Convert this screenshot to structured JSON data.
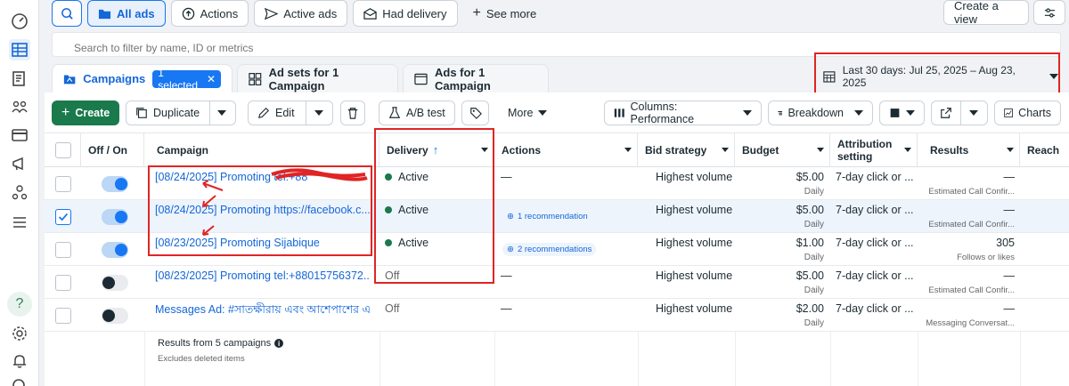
{
  "topbar": {
    "all_ads": "All ads",
    "actions": "Actions",
    "active_ads": "Active ads",
    "had_delivery": "Had delivery",
    "see_more": "See more",
    "create_view": "Create a view"
  },
  "search": {
    "placeholder": "Search to filter by name, ID or metrics"
  },
  "tabs": {
    "campaigns": "Campaigns",
    "selected_badge": "1 selected",
    "ad_sets": "Ad sets for 1 Campaign",
    "ads": "Ads for 1 Campaign"
  },
  "date_range": "Last 30 days: Jul 25, 2025 – Aug 23, 2025",
  "toolbar": {
    "create": "Create",
    "duplicate": "Duplicate",
    "edit": "Edit",
    "ab_test": "A/B test",
    "more": "More",
    "columns": "Columns: Performance",
    "breakdown": "Breakdown",
    "charts": "Charts"
  },
  "columns": {
    "off_on": "Off / On",
    "campaign": "Campaign",
    "delivery": "Delivery",
    "actions": "Actions",
    "bid_strategy": "Bid strategy",
    "budget": "Budget",
    "attribution": "Attribution setting",
    "results": "Results",
    "reach": "Reach"
  },
  "rows": [
    {
      "campaign": "[08/24/2025] Promoting tel:+88",
      "delivery": "Active",
      "actions": "—",
      "bid": "Highest volume",
      "budget": "$5.00",
      "budget_period": "Daily",
      "attribution": "7-day click or ...",
      "results": "—",
      "results_label": "Estimated Call Confir..."
    },
    {
      "campaign": "[08/24/2025] Promoting https://facebook.c...",
      "delivery": "Active",
      "actions": "1 recommendation",
      "bid": "Highest volume",
      "budget": "$5.00",
      "budget_period": "Daily",
      "attribution": "7-day click or ...",
      "results": "—",
      "results_label": "Estimated Call Confir..."
    },
    {
      "campaign": "[08/23/2025] Promoting Sijabique",
      "delivery": "Active",
      "actions": "2 recommendations",
      "bid": "Highest volume",
      "budget": "$1.00",
      "budget_period": "Daily",
      "attribution": "7-day click or ...",
      "results": "305",
      "results_label": "Follows or likes"
    },
    {
      "campaign": "[08/23/2025] Promoting tel:+88015756372...",
      "delivery": "Off",
      "actions": "—",
      "bid": "Highest volume",
      "budget": "$5.00",
      "budget_period": "Daily",
      "attribution": "7-day click or ...",
      "results": "—",
      "results_label": "Estimated Call Confir..."
    },
    {
      "campaign": "Messages Ad: #সাতক্ষীরায় এবং আশেপাশের এ...",
      "delivery": "Off",
      "actions": "—",
      "bid": "Highest volume",
      "budget": "$2.00",
      "budget_period": "Daily",
      "attribution": "7-day click or ...",
      "results": "—",
      "results_label": "Messaging Conversat..."
    }
  ],
  "footer": {
    "title": "Results from 5 campaigns",
    "subtitle": "Excludes deleted items"
  },
  "colors": {
    "accent": "#1877f2",
    "create_green": "#1a7a4c",
    "highlight_red": "#e02424"
  }
}
